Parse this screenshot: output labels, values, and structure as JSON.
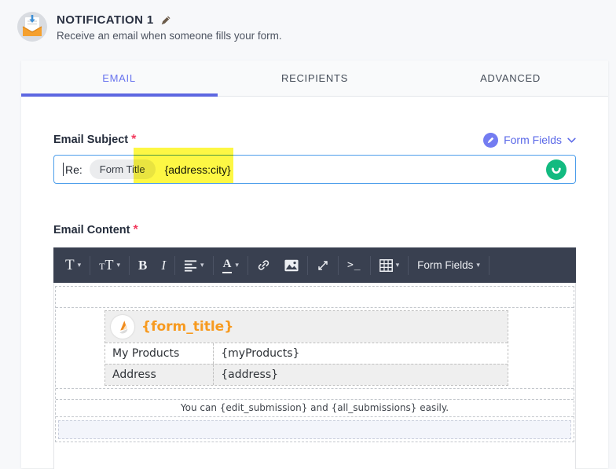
{
  "header": {
    "title": "NOTIFICATION 1",
    "subtitle": "Receive an email when someone fills your form."
  },
  "tabs": [
    {
      "label": "EMAIL",
      "active": true
    },
    {
      "label": "RECIPIENTS",
      "active": false
    },
    {
      "label": "ADVANCED",
      "active": false
    }
  ],
  "subject": {
    "label": "Email Subject",
    "required_mark": "*",
    "form_fields_label": "Form Fields",
    "input": {
      "prefix": "Re:",
      "chip": "Form Title",
      "token": "{address:city}"
    }
  },
  "content_field": {
    "label": "Email Content",
    "required_mark": "*"
  },
  "toolbar": {
    "font_button": "T",
    "size_small": "T",
    "size_large": "T",
    "bold": "B",
    "italic": "I",
    "color_letter": "A",
    "terminal": ">_",
    "form_fields": "Form Fields",
    "caret": "▾"
  },
  "email_preview": {
    "form_title": "{form_title}",
    "rows": [
      {
        "label": "My Products",
        "value": "{myProducts}"
      },
      {
        "label": "Address",
        "value": "{address}"
      }
    ],
    "note": "You can {edit_submission} and {all_submissions} easily."
  },
  "colors": {
    "accent_indigo": "#6974EE",
    "tab_underline": "#5D67E1",
    "input_border": "#4D9EEB",
    "saved_green": "#12BA80",
    "highlight_yellow": "#FCF405",
    "brand_orange": "#F79A1F",
    "required_red": "#F23A5E",
    "toolbar_bg": "#394050"
  }
}
